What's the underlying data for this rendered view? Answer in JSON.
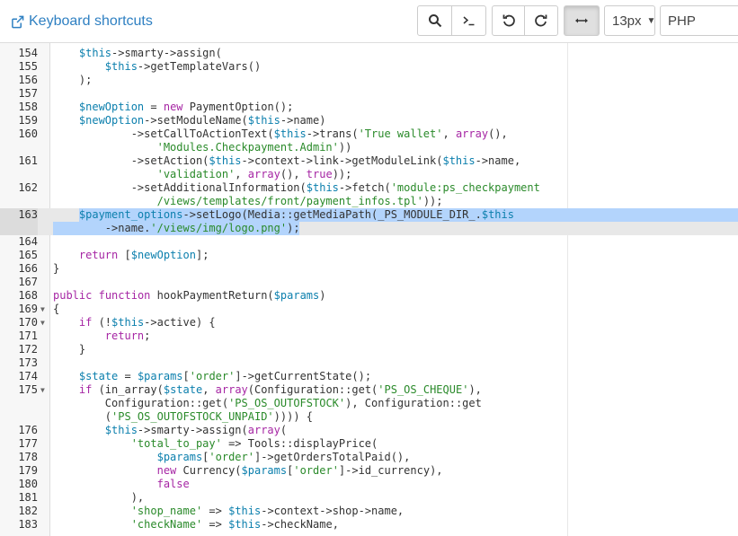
{
  "toolbar": {
    "keyboard_shortcuts_label": "Keyboard shortcuts",
    "font_size_value": "13px",
    "language_value": "PHP",
    "icons": [
      "search-icon",
      "terminal-icon",
      "undo-icon",
      "redo-icon",
      "wrap-toggle-icon"
    ]
  },
  "colors": {
    "link": "#2f80c2",
    "variable": "#0b7fad",
    "keyword": "#a626a4",
    "string": "#2a8a2a",
    "selection": "#b3d4fc",
    "gutter": "#f7f7f7"
  },
  "editor": {
    "current_line": "163",
    "rows": [
      {
        "num": "154",
        "fold": false,
        "lines": [
          [
            [
              "    ",
              ""
            ],
            [
              "$this",
              "var"
            ],
            [
              "->smarty->assign(",
              ""
            ]
          ]
        ]
      },
      {
        "num": "155",
        "fold": false,
        "lines": [
          [
            [
              "        ",
              ""
            ],
            [
              "$this",
              "var"
            ],
            [
              "->getTemplateVars()",
              ""
            ]
          ]
        ]
      },
      {
        "num": "156",
        "fold": false,
        "lines": [
          [
            [
              "    );",
              ""
            ]
          ]
        ]
      },
      {
        "num": "157",
        "fold": false,
        "lines": [
          [
            [
              "",
              ""
            ]
          ]
        ]
      },
      {
        "num": "158",
        "fold": false,
        "lines": [
          [
            [
              "    ",
              ""
            ],
            [
              "$newOption",
              "var"
            ],
            [
              " = ",
              ""
            ],
            [
              "new",
              "kw"
            ],
            [
              " PaymentOption();",
              ""
            ]
          ]
        ]
      },
      {
        "num": "159",
        "fold": false,
        "lines": [
          [
            [
              "    ",
              ""
            ],
            [
              "$newOption",
              "var"
            ],
            [
              "->setModuleName(",
              ""
            ],
            [
              "$this",
              "var"
            ],
            [
              "->name)",
              ""
            ]
          ]
        ]
      },
      {
        "num": "160",
        "fold": false,
        "lines": [
          [
            [
              "            ->setCallToActionText(",
              ""
            ],
            [
              "$this",
              "var"
            ],
            [
              "->trans(",
              ""
            ],
            [
              "'True wallet'",
              "str"
            ],
            [
              ", ",
              ""
            ],
            [
              "array",
              "kw"
            ],
            [
              "(),",
              ""
            ]
          ],
          [
            [
              "                ",
              ""
            ],
            [
              "'Modules.Checkpayment.Admin'",
              "str"
            ],
            [
              "))",
              ""
            ]
          ]
        ]
      },
      {
        "num": "161",
        "fold": false,
        "lines": [
          [
            [
              "            ->setAction(",
              ""
            ],
            [
              "$this",
              "var"
            ],
            [
              "->context->link->getModuleLink(",
              ""
            ],
            [
              "$this",
              "var"
            ],
            [
              "->name,",
              ""
            ]
          ],
          [
            [
              "                ",
              ""
            ],
            [
              "'validation'",
              "str"
            ],
            [
              ", ",
              ""
            ],
            [
              "array",
              "kw"
            ],
            [
              "(), ",
              ""
            ],
            [
              "true",
              "kw"
            ],
            [
              "));",
              ""
            ]
          ]
        ]
      },
      {
        "num": "162",
        "fold": false,
        "lines": [
          [
            [
              "            ->setAdditionalInformation(",
              ""
            ],
            [
              "$this",
              "var"
            ],
            [
              "->fetch(",
              ""
            ],
            [
              "'module:ps_checkpayment",
              "str"
            ]
          ],
          [
            [
              "                ",
              ""
            ],
            [
              "/views/templates/front/payment_infos.tpl'",
              "str"
            ],
            [
              "));",
              ""
            ]
          ]
        ]
      },
      {
        "num": "163",
        "fold": false,
        "lines": [
          [
            [
              "    ",
              ""
            ],
            [
              "$payment_options",
              "var"
            ],
            [
              "->setLogo(Media::getMediaPath(_PS_MODULE_DIR_.",
              ""
            ],
            [
              "$this",
              "var"
            ]
          ],
          [
            [
              "        ->name.",
              ""
            ],
            [
              "'/views/img/logo.png'",
              "str"
            ],
            [
              ");",
              ""
            ]
          ]
        ]
      },
      {
        "num": "164",
        "fold": false,
        "lines": [
          [
            [
              "",
              ""
            ]
          ]
        ]
      },
      {
        "num": "165",
        "fold": false,
        "lines": [
          [
            [
              "    ",
              ""
            ],
            [
              "return",
              "kw"
            ],
            [
              " [",
              ""
            ],
            [
              "$newOption",
              "var"
            ],
            [
              "];",
              ""
            ]
          ]
        ]
      },
      {
        "num": "166",
        "fold": false,
        "lines": [
          [
            [
              "}",
              ""
            ]
          ]
        ]
      },
      {
        "num": "167",
        "fold": false,
        "lines": [
          [
            [
              "",
              ""
            ]
          ]
        ]
      },
      {
        "num": "168",
        "fold": false,
        "lines": [
          [
            [
              "public",
              "kw"
            ],
            [
              " ",
              ""
            ],
            [
              "function",
              "kw"
            ],
            [
              " hookPaymentReturn(",
              ""
            ],
            [
              "$params",
              "var"
            ],
            [
              ")",
              ""
            ]
          ]
        ]
      },
      {
        "num": "169",
        "fold": true,
        "lines": [
          [
            [
              "{",
              ""
            ]
          ]
        ]
      },
      {
        "num": "170",
        "fold": true,
        "lines": [
          [
            [
              "    ",
              ""
            ],
            [
              "if",
              "kw"
            ],
            [
              " (!",
              ""
            ],
            [
              "$this",
              "var"
            ],
            [
              "->active) {",
              ""
            ]
          ]
        ]
      },
      {
        "num": "171",
        "fold": false,
        "lines": [
          [
            [
              "        ",
              ""
            ],
            [
              "return",
              "kw"
            ],
            [
              ";",
              ""
            ]
          ]
        ]
      },
      {
        "num": "172",
        "fold": false,
        "lines": [
          [
            [
              "    }",
              ""
            ]
          ]
        ]
      },
      {
        "num": "173",
        "fold": false,
        "lines": [
          [
            [
              "",
              ""
            ]
          ]
        ]
      },
      {
        "num": "174",
        "fold": false,
        "lines": [
          [
            [
              "    ",
              ""
            ],
            [
              "$state",
              "var"
            ],
            [
              " = ",
              ""
            ],
            [
              "$params",
              "var"
            ],
            [
              "[",
              ""
            ],
            [
              "'order'",
              "str"
            ],
            [
              "]->getCurrentState();",
              ""
            ]
          ]
        ]
      },
      {
        "num": "175",
        "fold": true,
        "lines": [
          [
            [
              "    ",
              ""
            ],
            [
              "if",
              "kw"
            ],
            [
              " (in_array(",
              ""
            ],
            [
              "$state",
              "var"
            ],
            [
              ", ",
              ""
            ],
            [
              "array",
              "kw"
            ],
            [
              "(Configuration::get(",
              ""
            ],
            [
              "'PS_OS_CHEQUE'",
              "str"
            ],
            [
              "),",
              ""
            ]
          ],
          [
            [
              "        Configuration::get(",
              ""
            ],
            [
              "'PS_OS_OUTOFSTOCK'",
              "str"
            ],
            [
              "), Configuration::get",
              ""
            ]
          ],
          [
            [
              "        (",
              ""
            ],
            [
              "'PS_OS_OUTOFSTOCK_UNPAID'",
              "str"
            ],
            [
              ")))) {",
              ""
            ]
          ]
        ]
      },
      {
        "num": "176",
        "fold": false,
        "lines": [
          [
            [
              "        ",
              ""
            ],
            [
              "$this",
              "var"
            ],
            [
              "->smarty->assign(",
              ""
            ],
            [
              "array",
              "kw"
            ],
            [
              "(",
              ""
            ]
          ]
        ]
      },
      {
        "num": "177",
        "fold": false,
        "lines": [
          [
            [
              "            ",
              ""
            ],
            [
              "'total_to_pay'",
              "str"
            ],
            [
              " => Tools::displayPrice(",
              ""
            ]
          ]
        ]
      },
      {
        "num": "178",
        "fold": false,
        "lines": [
          [
            [
              "                ",
              ""
            ],
            [
              "$params",
              "var"
            ],
            [
              "[",
              ""
            ],
            [
              "'order'",
              "str"
            ],
            [
              "]->getOrdersTotalPaid(),",
              ""
            ]
          ]
        ]
      },
      {
        "num": "179",
        "fold": false,
        "lines": [
          [
            [
              "                ",
              ""
            ],
            [
              "new",
              "kw"
            ],
            [
              " Currency(",
              ""
            ],
            [
              "$params",
              "var"
            ],
            [
              "[",
              ""
            ],
            [
              "'order'",
              "str"
            ],
            [
              "]->id_currency),",
              ""
            ]
          ]
        ]
      },
      {
        "num": "180",
        "fold": false,
        "lines": [
          [
            [
              "                ",
              ""
            ],
            [
              "false",
              "kw"
            ]
          ]
        ]
      },
      {
        "num": "181",
        "fold": false,
        "lines": [
          [
            [
              "            ),",
              ""
            ]
          ]
        ]
      },
      {
        "num": "182",
        "fold": false,
        "lines": [
          [
            [
              "            ",
              ""
            ],
            [
              "'shop_name'",
              "str"
            ],
            [
              " => ",
              ""
            ],
            [
              "$this",
              "var"
            ],
            [
              "->context->shop->name,",
              ""
            ]
          ]
        ]
      },
      {
        "num": "183",
        "fold": false,
        "lines": [
          [
            [
              "            ",
              ""
            ],
            [
              "'checkName'",
              "str"
            ],
            [
              " => ",
              ""
            ],
            [
              "$this",
              "var"
            ],
            [
              "->checkName,",
              ""
            ]
          ]
        ]
      }
    ]
  }
}
